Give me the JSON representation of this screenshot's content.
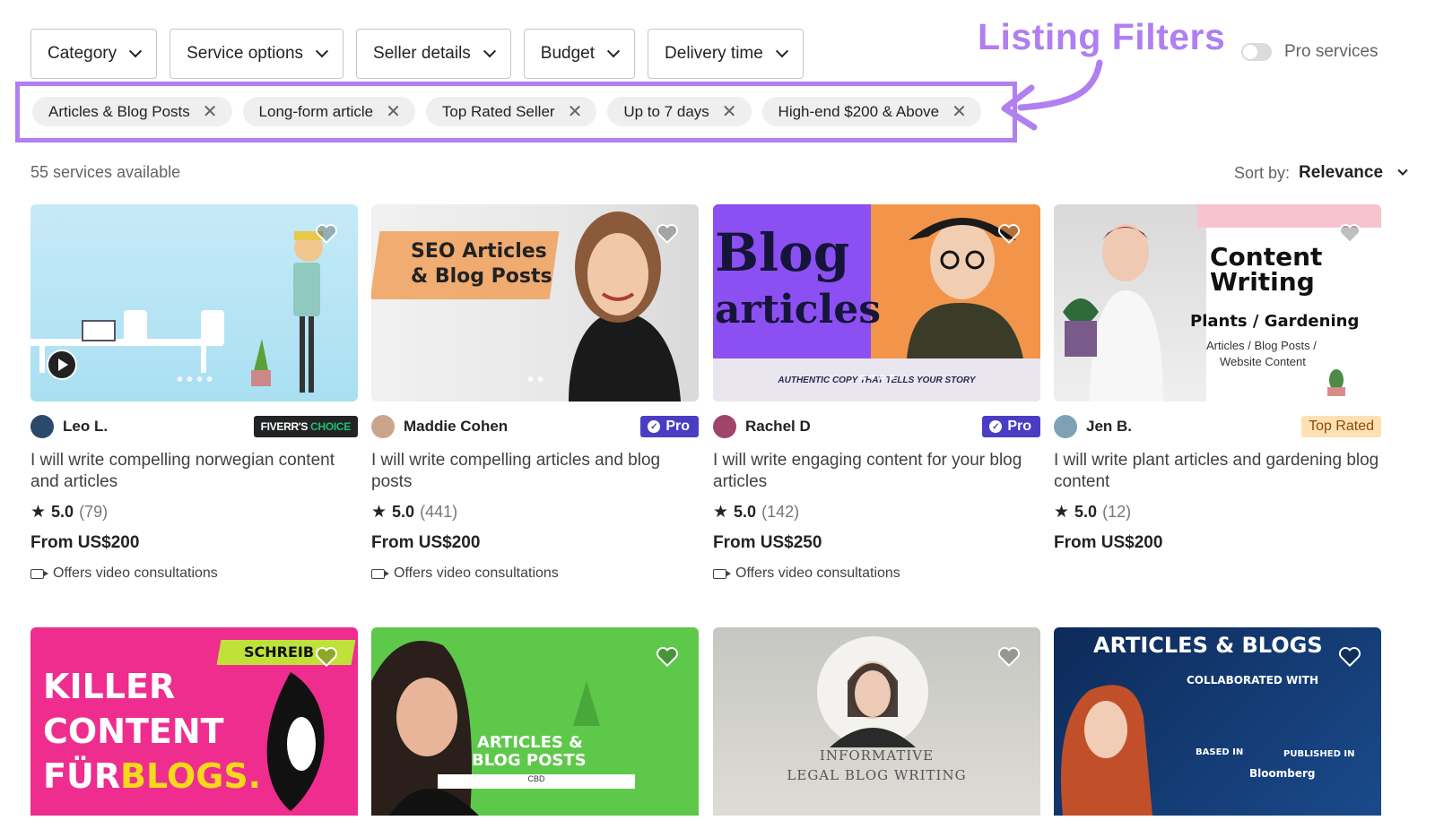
{
  "filters": [
    {
      "label": "Category"
    },
    {
      "label": "Service options"
    },
    {
      "label": "Seller details"
    },
    {
      "label": "Budget"
    },
    {
      "label": "Delivery time"
    }
  ],
  "annotation": "Listing Filters",
  "pro_services_label": "Pro services",
  "chips": [
    {
      "label": "Articles & Blog Posts"
    },
    {
      "label": "Long-form article"
    },
    {
      "label": "Top Rated Seller"
    },
    {
      "label": "Up to 7 days"
    },
    {
      "label": "High-end $200 & Above"
    }
  ],
  "results_count": "55 services available",
  "sort": {
    "label": "Sort by:",
    "value": "Relevance"
  },
  "cards": [
    {
      "seller": "Leo L.",
      "badge": "FIVERR'S",
      "badge2": "CHOICE",
      "title": "I will write compelling norwegian content and articles",
      "score": "5.0",
      "reviews": "(79)",
      "price": "From US$200",
      "video": "Offers video consultations"
    },
    {
      "seller": "Maddie Cohen",
      "badge": "Pro",
      "title": "I will write compelling articles and blog posts",
      "score": "5.0",
      "reviews": "(441)",
      "price": "From US$200",
      "video": "Offers video consultations",
      "img_line1": "SEO Articles",
      "img_line2": "& Blog Posts"
    },
    {
      "seller": "Rachel D",
      "badge": "Pro",
      "title": "I will write engaging content for your blog articles",
      "score": "5.0",
      "reviews": "(142)",
      "price": "From US$250",
      "video": "Offers video consultations",
      "img_line1": "Blog",
      "img_line2": "articles",
      "img_line3": "AUTHENTIC COPY THAT TELLS YOUR STORY"
    },
    {
      "seller": "Jen B.",
      "badge": "Top Rated",
      "title": "I will write plant articles and gardening blog content",
      "score": "5.0",
      "reviews": "(12)",
      "price": "From US$200",
      "img_line1": "Content",
      "img_line2": "Writing",
      "img_line3": "Plants / Gardening",
      "img_line4": "Articles / Blog Posts /",
      "img_line5": "Website Content"
    }
  ],
  "row2_images": [
    {
      "l1": "SCHREIB",
      "l2": "KILLER",
      "l3": "CONTENT",
      "l4": "FÜR",
      "l5": "BLOGS."
    },
    {
      "l1": "ARTICLES &",
      "l2": "BLOG POSTS",
      "l3": "CBD"
    },
    {
      "l1": "INFORMATIVE",
      "l2": "LEGAL BLOG WRITING"
    },
    {
      "l1": "ARTICLES & BLOGS",
      "l2": "COLLABORATED WITH",
      "l3": "BASED IN",
      "l4": "PUBLISHED IN",
      "l5": "Bloomberg"
    }
  ],
  "colors": {
    "accent": "#b07ff0",
    "pro": "#4a3dc4",
    "green": "#1dbf73"
  }
}
